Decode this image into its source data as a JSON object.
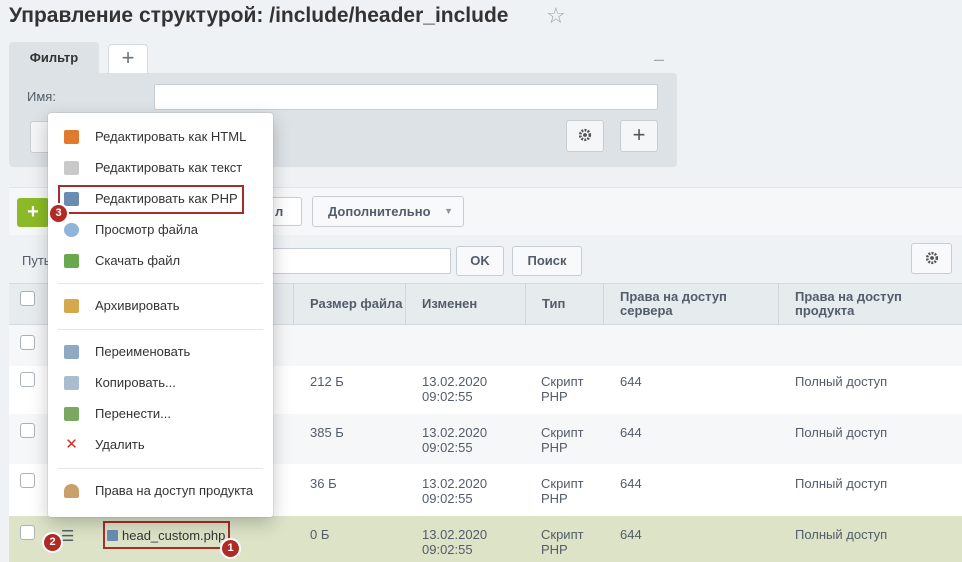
{
  "page": {
    "title": "Управление структурой: /include/header_include"
  },
  "filter": {
    "tab_label": "Фильтр",
    "add_tab_symbol": "+",
    "minimize_symbol": "–",
    "name_label": "Имя:",
    "add_symbol": "+"
  },
  "toolbar": {
    "add_symbol": "+",
    "hidden_button_label": "л",
    "more_label": "Дополнительно"
  },
  "path_bar": {
    "label": "Путь",
    "ok_label": "OK",
    "search_label": "Поиск"
  },
  "table": {
    "headers": [
      "Размер файла",
      "Изменен",
      "Тип",
      "Права на доступ сервера",
      "Права на доступ продукта"
    ],
    "rows": [
      {
        "size": "212 Б",
        "modified": "13.02.2020 09:02:55",
        "type": "Скрипт PHP",
        "server_rights": "644",
        "product_rights": "Полный доступ"
      },
      {
        "size": "385 Б",
        "modified": "13.02.2020 09:02:55",
        "type": "Скрипт PHP",
        "server_rights": "644",
        "product_rights": "Полный доступ"
      },
      {
        "size": "36 Б",
        "modified": "13.02.2020 09:02:55",
        "type": "Скрипт PHP",
        "server_rights": "644",
        "product_rights": "Полный доступ"
      },
      {
        "name": "head_custom.php",
        "size": "0 Б",
        "modified": "13.02.2020 09:02:55",
        "type": "Скрипт PHP",
        "server_rights": "644",
        "product_rights": "Полный доступ"
      }
    ]
  },
  "context_menu": {
    "items": [
      {
        "label": "Редактировать как HTML",
        "icon": "html-edit-icon"
      },
      {
        "label": "Редактировать как текст",
        "icon": "txt-edit-icon"
      },
      {
        "label": "Редактировать как PHP",
        "icon": "php-edit-icon"
      },
      {
        "label": "Просмотр файла",
        "icon": "view-file-icon"
      },
      {
        "label": "Скачать файл",
        "icon": "download-icon"
      },
      {
        "label": "Архивировать",
        "icon": "archive-icon"
      },
      {
        "label": "Переименовать",
        "icon": "rename-icon"
      },
      {
        "label": "Копировать...",
        "icon": "copy-icon"
      },
      {
        "label": "Перенести...",
        "icon": "move-icon"
      },
      {
        "label": "Удалить",
        "icon": "delete-icon"
      },
      {
        "label": "Права на доступ продукта",
        "icon": "access-rights-icon"
      }
    ]
  },
  "annotations": {
    "badge_1": "1",
    "badge_2": "2",
    "badge_3": "3"
  },
  "colors": {
    "accent_green": "#8cb927",
    "highlight_red": "#a52d2a",
    "selected_row": "#dce3c7"
  }
}
